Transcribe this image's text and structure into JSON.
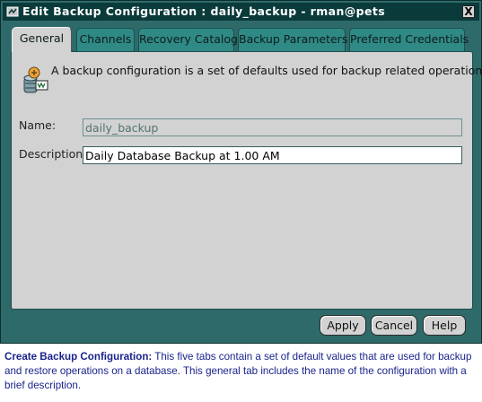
{
  "window": {
    "title": "Edit Backup Configuration : daily_backup - rman@pets",
    "close_label": "X",
    "colors": {
      "frame": "#2f6a6a",
      "titlebar": "#0a3a3a",
      "panel": "#d2d2d2",
      "tab": "#2f8a86"
    }
  },
  "tabs": [
    {
      "label": "General",
      "active": true
    },
    {
      "label": "Channels",
      "active": false
    },
    {
      "label": "Recovery Catalog",
      "active": false
    },
    {
      "label": "Backup Parameters",
      "active": false
    },
    {
      "label": "Preferred Credentials",
      "active": false
    }
  ],
  "general": {
    "info_icon": "backup-config-icon",
    "info_text": "A backup configuration is a set of defaults used for backup related operations.",
    "name_label": "Name:",
    "name_value": "daily_backup",
    "description_label": "Description:",
    "description_value": "Daily Database Backup at 1.00 AM"
  },
  "buttons": {
    "apply": "Apply",
    "cancel": "Cancel",
    "help": "Help"
  },
  "caption": {
    "lead": "Create Backup Configuration:",
    "text": " This five tabs contain a set of default values that are used for backup and restore operations on a database. This general tab includes the name of the configuration with a brief description.",
    "color": "#1a238c"
  }
}
